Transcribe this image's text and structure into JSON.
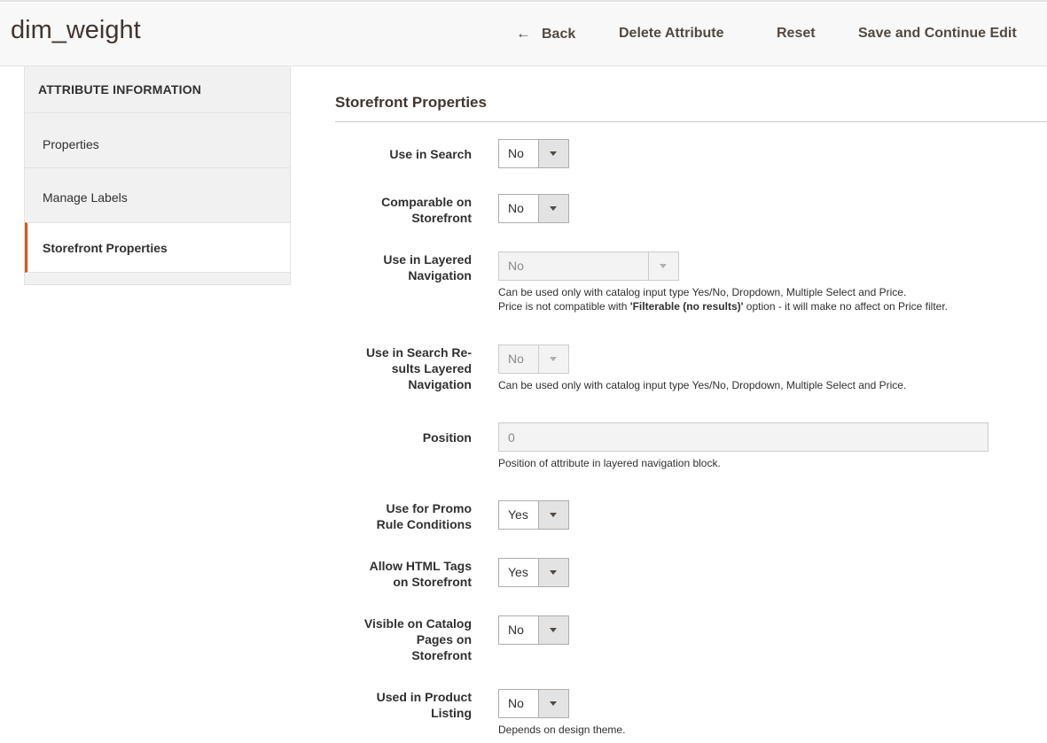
{
  "header": {
    "title": "dim_weight",
    "back_label": "Back",
    "delete_label": "Delete Attribute",
    "reset_label": "Reset",
    "save_label": "Save and Continue Edit"
  },
  "sidebar": {
    "heading": "ATTRIBUTE INFORMATION",
    "items": [
      {
        "label": "Properties"
      },
      {
        "label": "Manage Labels"
      },
      {
        "label": "Storefront Properties",
        "active": true
      }
    ]
  },
  "section": {
    "title": "Storefront Properties"
  },
  "fields": {
    "use_in_search": {
      "label": "Use in Search",
      "value": "No"
    },
    "comparable": {
      "label_line1": "Comparable on",
      "label_line2": "Storefront",
      "value": "No"
    },
    "layered_nav": {
      "label_line1": "Use in Layered",
      "label_line2": "Navigation",
      "value": "No",
      "note_line1": "Can be used only with catalog input type Yes/No, Dropdown, Multiple Select and Price.",
      "note_line2_pre": "Price is not compatible with ",
      "note_line2_bold": "'Filterable (no results)'",
      "note_line2_post": " option - it will make no affect on Price filter."
    },
    "search_results_nav": {
      "label_line1": "Use in Search Re-",
      "label_line2": "sults Layered",
      "label_line3": "Navigation",
      "value": "No",
      "note": "Can be used only with catalog input type Yes/No, Dropdown, Multiple Select and Price."
    },
    "position": {
      "label": "Position",
      "value": "0",
      "note": "Position of attribute in layered navigation block."
    },
    "promo_rules": {
      "label_line1": "Use for Promo",
      "label_line2": "Rule Conditions",
      "value": "Yes"
    },
    "html_tags": {
      "label_line1": "Allow HTML Tags",
      "label_line2": "on Storefront",
      "value": "Yes"
    },
    "visible_catalog": {
      "label_line1": "Visible on Catalog",
      "label_line2": "Pages on",
      "label_line3": "Storefront",
      "value": "No"
    },
    "product_listing": {
      "label_line1": "Used in Product",
      "label_line2": "Listing",
      "value": "No",
      "note": "Depends on design theme."
    }
  },
  "colors": {
    "accent": "#eb5202",
    "text": "#303030",
    "disabled_bg": "#f3f3f3"
  },
  "icons": {
    "back": "arrow-left-icon",
    "dropdown": "chevron-down-icon"
  }
}
